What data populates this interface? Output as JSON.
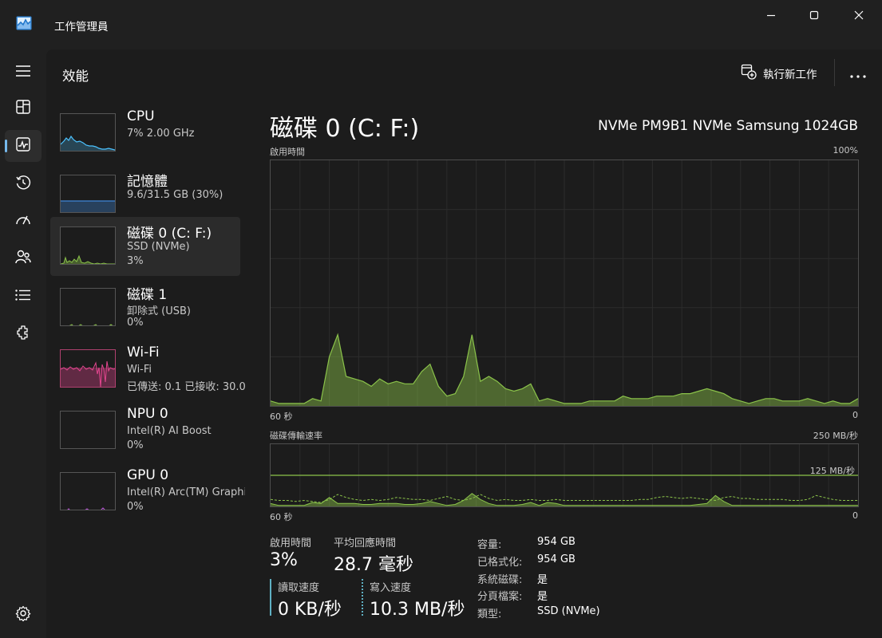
{
  "window": {
    "title": "工作管理員",
    "minimize_icon": "minimize-icon",
    "maximize_icon": "maximize-icon",
    "close_icon": "close-icon"
  },
  "nav": {
    "items": [
      {
        "icon": "hamburger-icon",
        "active": false
      },
      {
        "icon": "processes-icon",
        "active": false
      },
      {
        "icon": "performance-icon",
        "active": true
      },
      {
        "icon": "app-history-icon",
        "active": false
      },
      {
        "icon": "startup-apps-icon",
        "active": false
      },
      {
        "icon": "users-icon",
        "active": false
      },
      {
        "icon": "details-icon",
        "active": false
      },
      {
        "icon": "services-icon",
        "active": false
      }
    ],
    "settings_icon": "settings-icon"
  },
  "header": {
    "title": "效能",
    "run_task_label": "執行新工作",
    "more_icon": "more-icon"
  },
  "devices": [
    {
      "name": "CPU",
      "sub1": "7% 2.00 GHz",
      "sub2": "",
      "color": "#4cc2ff"
    },
    {
      "name": "記憶體",
      "sub1": "9.6/31.5 GB (30%)",
      "sub2": "",
      "color": "#3f86d8"
    },
    {
      "name": "磁碟 0 (C: F:)",
      "sub1": "SSD (NVMe)",
      "sub2": "3%",
      "color": "#8bc34a"
    },
    {
      "name": "磁碟 1",
      "sub1": "卸除式 (USB)",
      "sub2": "0%",
      "color": "#8bc34a"
    },
    {
      "name": "Wi-Fi",
      "sub1": "Wi-Fi",
      "sub2": "已傳送: 0.1 已接收: 30.0",
      "color": "#e3468f"
    },
    {
      "name": "NPU 0",
      "sub1": "Intel(R) AI Boost",
      "sub2": "0%",
      "color": "#4cc2ff"
    },
    {
      "name": "GPU 0",
      "sub1": "Intel(R) Arc(TM) Graphics",
      "sub2": "0%",
      "color": "#c057e0"
    }
  ],
  "main": {
    "title": "磁碟 0 (C: F:)",
    "model": "NVMe PM9B1 NVMe Samsung 1024GB",
    "active_graph": {
      "label": "啟用時間",
      "max_label": "100%",
      "time_left": "60 秒",
      "time_right": "0",
      "values": [
        2,
        1,
        1,
        1,
        1,
        3,
        2,
        20,
        29,
        12,
        11,
        10,
        8,
        11,
        9,
        10,
        9,
        9,
        14,
        17,
        8,
        4,
        5,
        12,
        29,
        10,
        12,
        10,
        7,
        6,
        7,
        9,
        2,
        3,
        2,
        1,
        1,
        1,
        2,
        2,
        2,
        2,
        4,
        3,
        3,
        3,
        4,
        4,
        4,
        5,
        5,
        6,
        7,
        6,
        5,
        3,
        2,
        1,
        2,
        3,
        3,
        2,
        2,
        2,
        3,
        2,
        1,
        2,
        1,
        1,
        3
      ],
      "color": "#8bc34a"
    },
    "transfer_graph": {
      "label": "磁碟傳輸速率",
      "max_label": "250 MB/秒",
      "mid_label": "125 MB/秒",
      "time_left": "60 秒",
      "time_right": "0",
      "read_values": [
        3,
        1,
        1,
        1,
        1,
        4,
        3,
        9,
        3,
        3,
        3,
        2,
        2,
        3,
        3,
        3,
        2,
        2,
        3,
        5,
        3,
        1,
        2,
        6,
        13,
        7,
        3,
        1,
        1,
        1,
        2,
        4,
        1,
        4,
        3,
        1,
        1,
        1,
        1,
        1,
        1,
        1,
        1,
        1,
        1,
        1,
        1,
        1,
        1,
        1,
        1,
        2,
        3,
        11,
        5,
        1,
        1,
        1,
        1,
        1,
        1,
        1,
        1,
        1,
        1,
        1,
        1,
        1,
        1,
        1,
        1
      ],
      "write_values": [
        7,
        6,
        6,
        5,
        6,
        5,
        4,
        7,
        12,
        9,
        7,
        6,
        7,
        6,
        7,
        9,
        8,
        7,
        7,
        6,
        8,
        10,
        7,
        6,
        8,
        12,
        8,
        6,
        7,
        6,
        6,
        7,
        6,
        6,
        7,
        6,
        6,
        6,
        6,
        6,
        6,
        6,
        6,
        6,
        7,
        7,
        9,
        10,
        9,
        8,
        9,
        8,
        7,
        6,
        9,
        10,
        8,
        8,
        7,
        7,
        7,
        7,
        6,
        6,
        7,
        11,
        9,
        7,
        6,
        6,
        6
      ],
      "scale_max": 250,
      "color": "#8bc34a"
    },
    "stats": {
      "active_time_label": "啟用時間",
      "active_time_value": "3%",
      "avg_response_label": "平均回應時間",
      "avg_response_value": "28.7 毫秒",
      "read_speed_label": "讀取速度",
      "read_speed_value": "0 KB/秒",
      "write_speed_label": "寫入速度",
      "write_speed_value": "10.3 MB/秒"
    },
    "properties": [
      {
        "label": "容量:",
        "value": "954 GB"
      },
      {
        "label": "已格式化:",
        "value": "954 GB"
      },
      {
        "label": "系統磁碟:",
        "value": "是"
      },
      {
        "label": "分頁檔案:",
        "value": "是"
      },
      {
        "label": "類型:",
        "value": "SSD (NVMe)"
      }
    ]
  }
}
